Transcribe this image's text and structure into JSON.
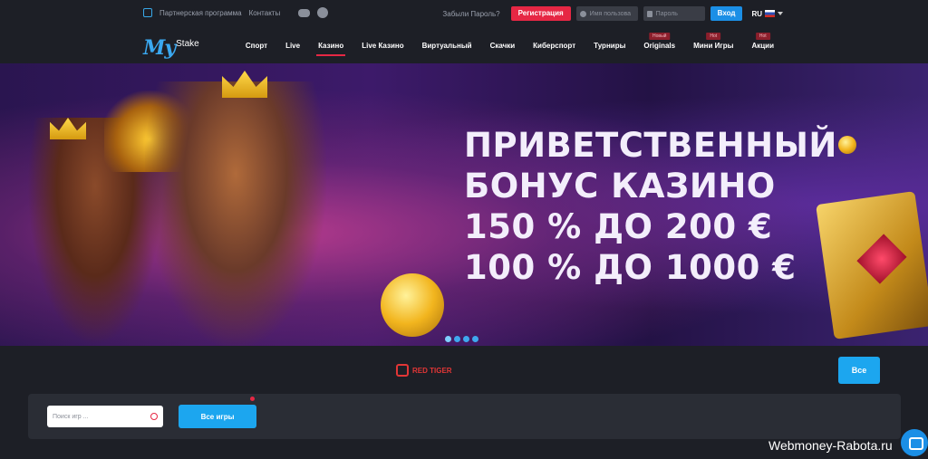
{
  "topbar": {
    "partner_program": "Партнерская программа",
    "contacts": "Контакты",
    "forgot_password": "Забыли Пароль?",
    "register": "Регистрация",
    "username_placeholder": "Имя пользова",
    "password_placeholder": "Пароль",
    "login": "Вход",
    "language": "RU"
  },
  "logo": {
    "my": "My",
    "stake": "Stake"
  },
  "menu": {
    "items": [
      {
        "label": "Спорт"
      },
      {
        "label": "Live"
      },
      {
        "label": "Казино"
      },
      {
        "label": "Live Казино"
      },
      {
        "label": "Виртуальный"
      },
      {
        "label": "Скачки"
      },
      {
        "label": "Киберспорт"
      },
      {
        "label": "Турниры"
      },
      {
        "label": "Originals",
        "badge": "Новый"
      },
      {
        "label": "Мини Игры",
        "badge": "Hot"
      },
      {
        "label": "Акции",
        "badge": "Hot"
      }
    ],
    "active_index": 2
  },
  "banner": {
    "line1": "ПРИВЕТСТВЕННЫЙ",
    "line2": "БОНУС КАЗИНО",
    "line3": "150 % ДО 200 €",
    "line4": "100 % ДО 1000 €",
    "slides": 4,
    "active_slide": 0
  },
  "provider": {
    "name": "RED TIGER",
    "all_button": "Все"
  },
  "search": {
    "placeholder": "Поиск игр ...",
    "all_games": "Все игры"
  },
  "watermark": "Webmoney-Rabota.ru",
  "colors": {
    "accent_red": "#e62744",
    "accent_blue": "#1ca6ef",
    "background": "#1d1f26"
  }
}
